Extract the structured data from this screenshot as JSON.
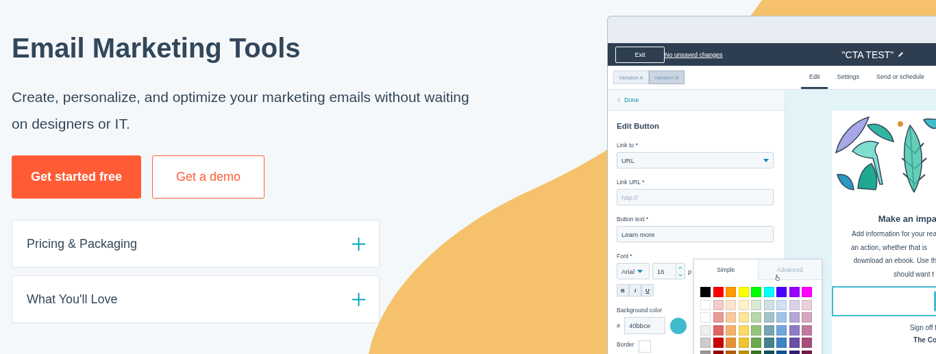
{
  "hero": {
    "title": "Email Marketing Tools",
    "subtitle": "Create, personalize, and optimize your marketing emails without waiting on designers or IT."
  },
  "buttons": [
    {
      "label": "Get started free",
      "kind": "primary"
    },
    {
      "label": "Get a demo",
      "kind": "secondary"
    }
  ],
  "accordion": [
    {
      "label": "Pricing & Packaging",
      "expanded": false
    },
    {
      "label": "What You'll Love",
      "expanded": false
    }
  ],
  "editor": {
    "exit_button": "Exit",
    "save_status": "No unsaved changes",
    "email_title": "\"CTA TEST\"",
    "variations": [
      {
        "label": "Variation A",
        "selected": false
      },
      {
        "label": "Variation B",
        "selected": true
      }
    ],
    "tabs": [
      {
        "label": "Edit",
        "selected": true
      },
      {
        "label": "Settings",
        "selected": false
      },
      {
        "label": "Send or schedule",
        "selected": false
      }
    ],
    "panel": {
      "back_link": "Done",
      "heading": "Edit Button",
      "fields": [
        {
          "label": "Link to *",
          "kind": "select",
          "value": "URL"
        },
        {
          "label": "Link URL *",
          "kind": "text",
          "placeholder": "http://"
        },
        {
          "label": "Button text *",
          "kind": "text",
          "value": "Learn more"
        }
      ],
      "font": {
        "label": "Font *",
        "family": "Arial",
        "size": "16",
        "unit": "p"
      },
      "format_buttons": [
        "B",
        "I",
        "U"
      ],
      "background": {
        "label": "Background color",
        "hash": "#",
        "value": "40bbce",
        "color": "#40bbce"
      },
      "border_label": "Border"
    },
    "color_picker": {
      "tabs": [
        {
          "label": "Simple",
          "selected": true
        },
        {
          "label": "Advanced",
          "selected": false
        }
      ],
      "rows": [
        {
          "swatches": [
            {
              "color": "#000000"
            },
            {
              "color": "#ff0000"
            },
            {
              "color": "#ff9900"
            },
            {
              "color": "#ffff00"
            },
            {
              "color": "#00ff00"
            },
            {
              "color": "#00ffff"
            },
            {
              "color": "#4a00ff"
            },
            {
              "color": "#9900ff"
            },
            {
              "color": "#ff00ff"
            }
          ]
        },
        {
          "swatches": [
            {
              "color": "#ffffff"
            },
            {
              "color": "#f4cccc"
            },
            {
              "color": "#fce5cd"
            },
            {
              "color": "#fff2cc"
            },
            {
              "color": "#d9ead3"
            },
            {
              "color": "#d0e0e3"
            },
            {
              "color": "#cfe2f3"
            },
            {
              "color": "#d9d2e9"
            },
            {
              "color": "#ead1dc"
            }
          ]
        },
        {
          "swatches": [
            {
              "color": "#ffffff"
            },
            {
              "color": "#ea9999"
            },
            {
              "color": "#f9cb9c"
            },
            {
              "color": "#ffe599"
            },
            {
              "color": "#b6d7a8"
            },
            {
              "color": "#a2c4c9"
            },
            {
              "color": "#9fc5e8"
            },
            {
              "color": "#b4a7d6"
            },
            {
              "color": "#d5a6bd"
            }
          ]
        },
        {
          "swatches": [
            {
              "color": "#eeeeee"
            },
            {
              "color": "#e06666"
            },
            {
              "color": "#f6b26b"
            },
            {
              "color": "#ffd966"
            },
            {
              "color": "#93c47d"
            },
            {
              "color": "#76a5af"
            },
            {
              "color": "#6fa8dc"
            },
            {
              "color": "#8e7cc3"
            },
            {
              "color": "#c27ba0"
            }
          ]
        },
        {
          "swatches": [
            {
              "color": "#cccccc"
            },
            {
              "color": "#cc0000"
            },
            {
              "color": "#e69138"
            },
            {
              "color": "#f1c232"
            },
            {
              "color": "#6aa84f"
            },
            {
              "color": "#45818e"
            },
            {
              "color": "#3d85c6"
            },
            {
              "color": "#674ea7"
            },
            {
              "color": "#a64d79"
            }
          ]
        },
        {
          "swatches": [
            {
              "color": "#999999"
            },
            {
              "color": "#990000"
            },
            {
              "color": "#b45f06"
            },
            {
              "color": "#bf9000"
            },
            {
              "color": "#38761d"
            },
            {
              "color": "#134f5c"
            },
            {
              "color": "#0b5394"
            },
            {
              "color": "#351c75"
            },
            {
              "color": "#741b47"
            }
          ]
        }
      ]
    },
    "preview": {
      "heading": "Make an impa",
      "lines": [
        "Add information for your rea",
        "an action, whether that is",
        "download an ebook. Use th",
        "should want t"
      ],
      "signoff": "Sign off f",
      "signature": "The Co"
    }
  }
}
